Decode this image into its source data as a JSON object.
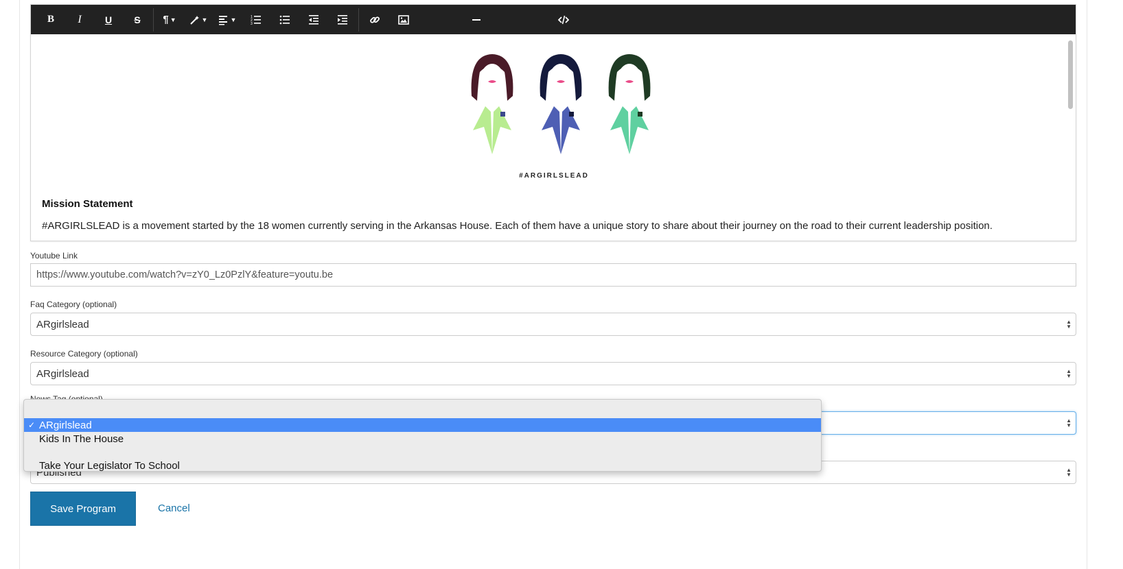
{
  "toolbar": {
    "icons": [
      "bold-icon",
      "italic-icon",
      "underline-icon",
      "strikethrough-icon",
      "paragraph-icon",
      "magic-style-icon",
      "align-icon",
      "ordered-list-icon",
      "unordered-list-icon",
      "outdent-icon",
      "indent-icon",
      "link-icon",
      "image-icon",
      "horizontal-rule-icon",
      "code-view-icon"
    ]
  },
  "editor": {
    "hashtag": "#ARGIRLSLEAD",
    "mission_title": "Mission Statement",
    "mission_text": "#ARGIRLSLEAD is a movement started by the 18 women currently serving in the Arkansas House. Each of them have a unique story to share about their journey on the road to their current leadership position."
  },
  "form": {
    "youtube_label": "Youtube Link",
    "youtube_value": "https://www.youtube.com/watch?v=zY0_Lz0PzlY&feature=youtu.be",
    "faq_label": "Faq Category (optional)",
    "faq_value": "ARgirlslead",
    "resource_label": "Resource Category (optional)",
    "resource_value": "ARgirlslead",
    "news_label": "News Tag (optional)",
    "status_value": "Published"
  },
  "dropdown": {
    "options": [
      {
        "label": "ARgirlslead",
        "selected": true
      },
      {
        "label": "Kids In The House",
        "selected": false
      },
      {
        "label": "Take Your Legislator To School",
        "selected": false
      }
    ],
    "check": "✓"
  },
  "actions": {
    "save_label": "Save Program",
    "cancel_label": "Cancel"
  },
  "colors": {
    "toolbar_bg": "#222222",
    "primary": "#1a74a8",
    "selection": "#4a8cf7"
  }
}
